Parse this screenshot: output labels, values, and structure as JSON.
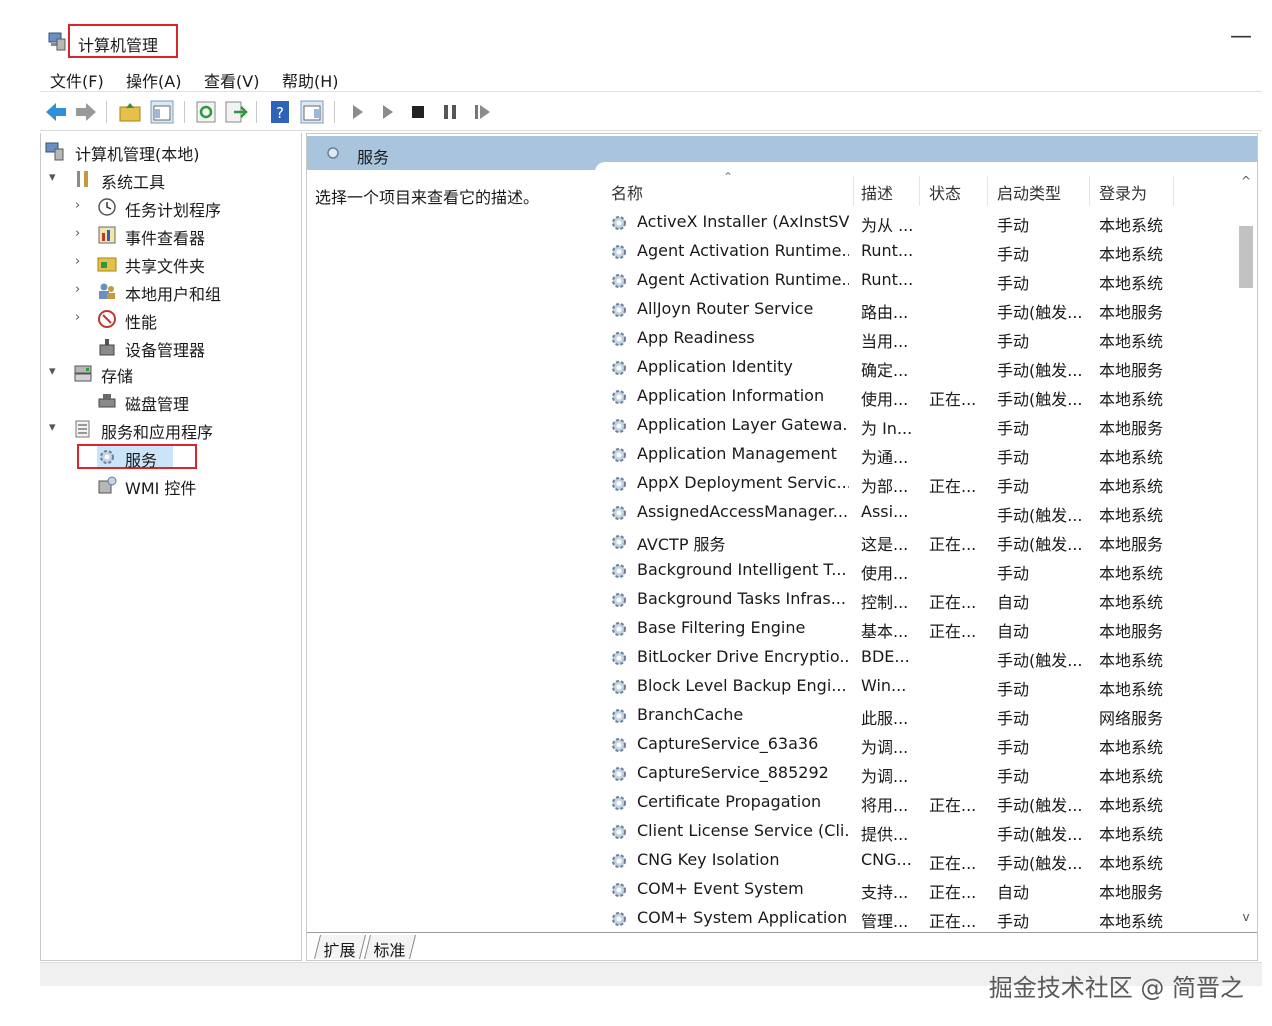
{
  "window": {
    "title": "计算机管理",
    "minimize_symbol": "—"
  },
  "menu": [
    "文件(F)",
    "操作(A)",
    "查看(V)",
    "帮助(H)"
  ],
  "toolbar_icons": [
    "back-arrow-icon",
    "forward-arrow-icon",
    "up-folder-icon",
    "console-tree-icon",
    "refresh-icon",
    "export-list-icon",
    "help-icon",
    "view-icon",
    "start-service-icon",
    "start-alt-icon",
    "stop-icon",
    "pause-icon",
    "resume-icon"
  ],
  "tree": {
    "root": "计算机管理(本地)",
    "system_tools": "系统工具",
    "task_scheduler": "任务计划程序",
    "event_viewer": "事件查看器",
    "shared_folders": "共享文件夹",
    "local_users": "本地用户和组",
    "performance": "性能",
    "device_manager": "设备管理器",
    "storage": "存储",
    "disk_management": "磁盘管理",
    "services_apps": "服务和应用程序",
    "services": "服务",
    "wmi": "WMI 控件"
  },
  "main": {
    "header_title": "服务",
    "description": "选择一个项目来查看它的描述。",
    "columns": {
      "name": "名称",
      "desc": "描述",
      "status": "状态",
      "startup": "启动类型",
      "logon": "登录为"
    },
    "rows": [
      [
        "ActiveX Installer (AxInstSV)",
        "为从 ...",
        "",
        "手动",
        "本地系统"
      ],
      [
        "Agent Activation Runtime...",
        "Runt...",
        "",
        "手动",
        "本地系统"
      ],
      [
        "Agent Activation Runtime...",
        "Runt...",
        "",
        "手动",
        "本地系统"
      ],
      [
        "AllJoyn Router Service",
        "路由...",
        "",
        "手动(触发...",
        "本地服务"
      ],
      [
        "App Readiness",
        "当用...",
        "",
        "手动",
        "本地系统"
      ],
      [
        "Application Identity",
        "确定...",
        "",
        "手动(触发...",
        "本地服务"
      ],
      [
        "Application Information",
        "使用...",
        "正在...",
        "手动(触发...",
        "本地系统"
      ],
      [
        "Application Layer Gatewa...",
        "为 In...",
        "",
        "手动",
        "本地服务"
      ],
      [
        "Application Management",
        "为通...",
        "",
        "手动",
        "本地系统"
      ],
      [
        "AppX Deployment Servic...",
        "为部...",
        "正在...",
        "手动",
        "本地系统"
      ],
      [
        "AssignedAccessManager...",
        "Assi...",
        "",
        "手动(触发...",
        "本地系统"
      ],
      [
        "AVCTP 服务",
        "这是...",
        "正在...",
        "手动(触发...",
        "本地服务"
      ],
      [
        "Background Intelligent T...",
        "使用...",
        "",
        "手动",
        "本地系统"
      ],
      [
        "Background Tasks Infras...",
        "控制...",
        "正在...",
        "自动",
        "本地系统"
      ],
      [
        "Base Filtering Engine",
        "基本...",
        "正在...",
        "自动",
        "本地服务"
      ],
      [
        "BitLocker Drive Encryptio...",
        "BDE...",
        "",
        "手动(触发...",
        "本地系统"
      ],
      [
        "Block Level Backup Engi...",
        "Win...",
        "",
        "手动",
        "本地系统"
      ],
      [
        "BranchCache",
        "此服...",
        "",
        "手动",
        "网络服务"
      ],
      [
        "CaptureService_63a36",
        "为调...",
        "",
        "手动",
        "本地系统"
      ],
      [
        "CaptureService_885292",
        "为调...",
        "",
        "手动",
        "本地系统"
      ],
      [
        "Certificate Propagation",
        "将用...",
        "正在...",
        "手动(触发...",
        "本地系统"
      ],
      [
        "Client License Service (Cli...",
        "提供...",
        "",
        "手动(触发...",
        "本地系统"
      ],
      [
        "CNG Key Isolation",
        "CNG...",
        "正在...",
        "手动(触发...",
        "本地系统"
      ],
      [
        "COM+ Event System",
        "支持...",
        "正在...",
        "自动",
        "本地服务"
      ],
      [
        "COM+ System Application",
        "管理...",
        "正在...",
        "手动",
        "本地系统"
      ]
    ],
    "scroll_up": "^",
    "scroll_down": "v"
  },
  "tabs": [
    "扩展",
    "标准"
  ],
  "watermark": "掘金技术社区 @ 简晋之"
}
